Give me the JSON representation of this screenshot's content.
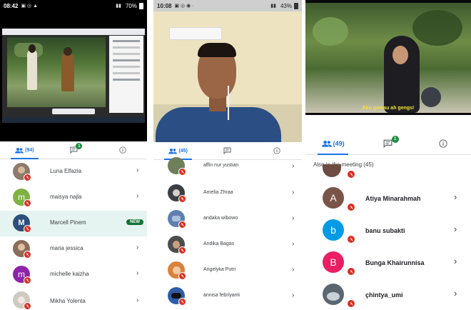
{
  "panel1": {
    "status": {
      "time": "08:42",
      "battery": "70%"
    },
    "tabs": {
      "people_count": "(94)",
      "chat_badge": "1"
    },
    "participants": [
      {
        "name": "Luna Elfazia",
        "avatar_type": "photo",
        "avatar_color": "#8d7a6b"
      },
      {
        "name": "maisya najla",
        "avatar_type": "letter",
        "letter": "m",
        "avatar_color": "#7cb342"
      },
      {
        "name": "Marcell Pinem",
        "avatar_type": "photo",
        "avatar_color": "#2c4f7c",
        "highlight": true,
        "tag": "NEW"
      },
      {
        "name": "maria jessica",
        "avatar_type": "photo",
        "avatar_color": "#8a6d5a"
      },
      {
        "name": "michelle kaizha",
        "avatar_type": "letter",
        "letter": "m",
        "avatar_color": "#8e24aa"
      },
      {
        "name": "Mikha Yolenta",
        "avatar_type": "photo",
        "avatar_color": "#cfc9bf"
      }
    ]
  },
  "panel2": {
    "status": {
      "time": "10:08",
      "battery": "43%"
    },
    "tabs": {
      "people_count": "(45)"
    },
    "participants": [
      {
        "name": "affin nur yustian",
        "avatar_color": "#6e7f59"
      },
      {
        "name": "Amelia Zhraa",
        "avatar_color": "#3b3f46"
      },
      {
        "name": "andaka wibowo",
        "avatar_color": "#5f7fb0"
      },
      {
        "name": "Andika Bagas",
        "avatar_color": "#4d4d4d"
      },
      {
        "name": "Angelyka Putri",
        "avatar_color": "#d9823b"
      },
      {
        "name": "annisa febriyanti",
        "avatar_color": "#2f5da8"
      }
    ]
  },
  "panel3": {
    "tabs": {
      "people_count": "(49)",
      "chat_badge": "1"
    },
    "video_caption": "Aku gamau ah gengs!",
    "section_header": "Also in the meeting (45)",
    "participants": [
      {
        "name": "Atiya Minarahmah",
        "letter": "A",
        "avatar_color": "#795548"
      },
      {
        "name": "banu subakti",
        "letter": "b",
        "avatar_color": "#039be5"
      },
      {
        "name": "Bunga Khairunnisa",
        "letter": "B",
        "avatar_color": "#e91e63"
      },
      {
        "name": "çhintya_umi",
        "avatar_type": "photo",
        "avatar_color": "#5b6770"
      }
    ]
  }
}
